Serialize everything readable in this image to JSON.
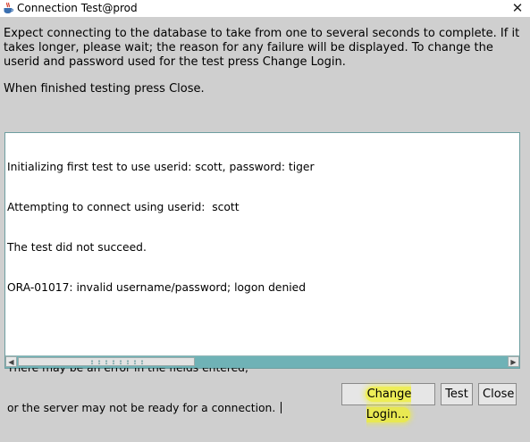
{
  "window": {
    "title": "Connection Test@prod",
    "app_icon": "java-cup-icon",
    "close_glyph": "✕"
  },
  "instructions": {
    "paragraph1": "Expect connecting to the database to take from one to several seconds to complete. If it takes longer, please wait; the reason for any failure will be displayed. To change the userid and password used for the test press Change Login.",
    "paragraph2": "When finished testing press Close."
  },
  "log": {
    "lines": [
      "Initializing first test to use userid: scott, password: tiger",
      "Attempting to connect using userid:  scott",
      "The test did not succeed.",
      "ORA-01017: invalid username/password; logon denied",
      "",
      "There may be an error in the fields entered,",
      "or the server may not be ready for a connection. "
    ]
  },
  "buttons": {
    "change_login": "Change Login...",
    "test": "Test",
    "close": "Close"
  },
  "colors": {
    "background": "#cfcfcf",
    "scrollbar": "#6fb2b6",
    "highlight": "#f0f028"
  }
}
